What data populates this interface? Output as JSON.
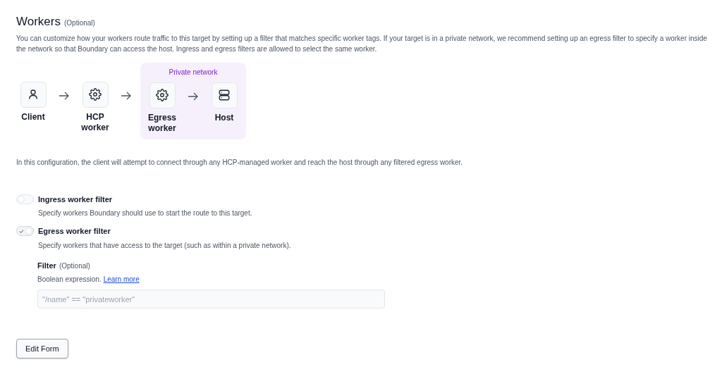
{
  "section": {
    "title": "Workers",
    "optional": "(Optional)",
    "description": "You can customize how your workers route traffic to this target by setting up a filter that matches specific worker tags. If your target is in a private network, we recommend setting up an egress filter to specify a worker inside the network so that Boundary can access the host. Ingress and egress filters are allowed to select the same worker."
  },
  "diagram": {
    "nodes": [
      {
        "kind": "person",
        "label": "Client"
      },
      {
        "kind": "gear",
        "label": "HCP worker"
      }
    ],
    "private_network": {
      "label": "Private network",
      "nodes": [
        {
          "kind": "gear",
          "label": "Egress worker"
        },
        {
          "kind": "server",
          "label": "Host"
        }
      ]
    }
  },
  "explanation": "In this configuration, the client will attempt to connect through any HCP-managed worker and reach the host through any filtered egress worker.",
  "toggles": [
    {
      "label": "Ingress worker filter",
      "description": "Specify workers Boundary should use to start the route to this target.",
      "on": false
    },
    {
      "label": "Egress worker filter",
      "description": "Specify workers that have access to the target (such as within a private network).",
      "on": true
    }
  ],
  "filter": {
    "label": "Filter",
    "optional": "(Optional)",
    "help": "Boolean expression.",
    "link": "Learn more",
    "value": "\"/name\" == \"privateworker\"",
    "disabled": true
  },
  "buttons": [
    "Edit Form"
  ]
}
